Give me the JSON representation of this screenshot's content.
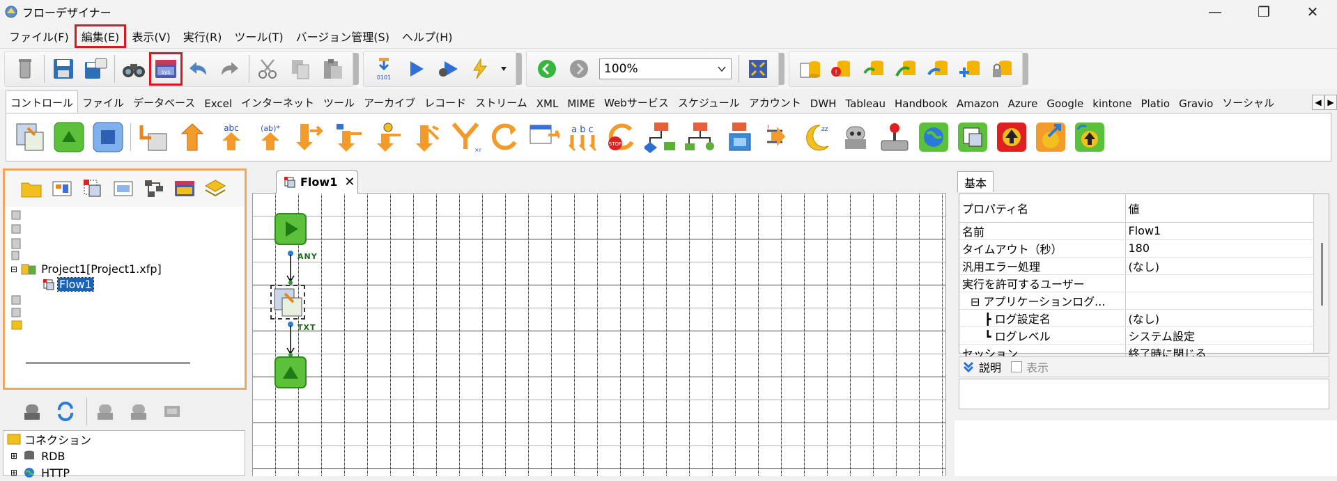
{
  "window": {
    "title": "フローデザイナー",
    "controls": {
      "minimize": "—",
      "maximize": "❐",
      "close": "✕"
    }
  },
  "menu": {
    "items": [
      "ファイル(F)",
      "編集(E)",
      "表示(V)",
      "実行(R)",
      "ツール(T)",
      "バージョン管理(S)",
      "ヘルプ(H)"
    ],
    "highlighted_index": 1
  },
  "toolbar": {
    "zoom_value": "100%",
    "highlighted_button": "sys-variables-button"
  },
  "palette_tabs": {
    "items": [
      "コントロール",
      "ファイル",
      "データベース",
      "Excel",
      "インターネット",
      "ツール",
      "アーカイブ",
      "レコード",
      "ストリーム",
      "XML",
      "MIME",
      "Webサービス",
      "スケジュール",
      "アカウント",
      "DWH",
      "Tableau",
      "Handbook",
      "Amazon",
      "Azure",
      "Google",
      "kintone",
      "Platio",
      "Gravio",
      "ソーシャル"
    ],
    "active_index": 0,
    "palette_text_abc": "abc",
    "palette_text_ab": "(ab)*",
    "palette_text_abc2": "a b c"
  },
  "project_tree": {
    "project_label": "Project1[Project1.xfp]",
    "flow_label": "Flow1"
  },
  "connections": {
    "root": "コネクション",
    "items": [
      "RDB",
      "HTTP"
    ]
  },
  "canvas": {
    "tab_label": "Flow1",
    "tab_close": "✕",
    "link_label_1": "ANY",
    "link_label_2": "TXT"
  },
  "properties": {
    "tab": "基本",
    "header_name": "プロパティ名",
    "header_value": "値",
    "rows": [
      {
        "name": "名前",
        "value": "Flow1"
      },
      {
        "name": "タイムアウト（秒）",
        "value": "180"
      },
      {
        "name": "汎用エラー処理",
        "value": "(なし)"
      },
      {
        "name": "実行を許可するユーザー",
        "value": ""
      },
      {
        "name": "⊟ アプリケーションログ...",
        "value": ""
      },
      {
        "name": "┣ ログ設定名",
        "value": "(なし)"
      },
      {
        "name": "┗ ログレベル",
        "value": "システム設定"
      },
      {
        "name": "セッション",
        "value": "終了時に閉じる"
      }
    ],
    "description_label": "説明",
    "show_label": "表示"
  },
  "colors": {
    "highlight_red": "#e0141e",
    "panel_orange": "#f1a65c",
    "selection_blue": "#1565c0",
    "link_green": "#1b6b16"
  }
}
